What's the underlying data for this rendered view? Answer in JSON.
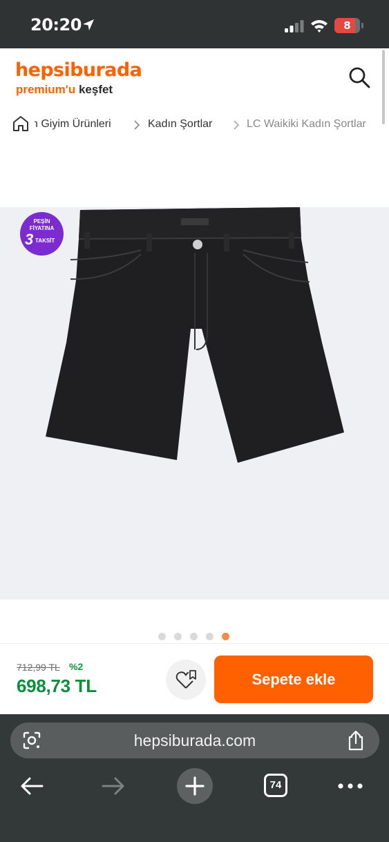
{
  "status_bar": {
    "time": "20:20",
    "battery": "8",
    "battery_level": 0.08
  },
  "header": {
    "logo": "hepsiburada",
    "tagline_orange": "premium'u",
    "tagline_dark": " keşfet",
    "search_icon": "search-icon"
  },
  "breadcrumb": {
    "items": [
      {
        "label": "n Giyim Ürünleri"
      },
      {
        "label": "Kadın Şortlar"
      },
      {
        "label": "LC Waikiki Kadın Şortlar"
      }
    ]
  },
  "product": {
    "badge": {
      "line1": "PEŞİN",
      "line2": "FİYATINA",
      "number": "3",
      "line3": "TAKSİT",
      "color": "#7c2bd1"
    },
    "image": "black-denim-shorts",
    "gallery": {
      "count": 5,
      "active_index": 4,
      "active_color": "#f68b4c"
    }
  },
  "price_bar": {
    "old_price": "712,99 TL",
    "discount": "%2",
    "price": "698,73 TL",
    "add_to_cart": "Sepete ekle",
    "brand_color": "#ff6000"
  },
  "browser": {
    "url": "hepsiburada.com",
    "tab_count": "74"
  }
}
